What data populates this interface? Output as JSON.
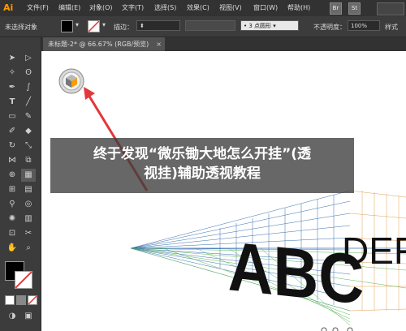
{
  "app": {
    "logo": "Ai"
  },
  "menu": [
    "文件(F)",
    "编辑(E)",
    "对象(O)",
    "文字(T)",
    "选择(S)",
    "效果(C)",
    "视图(V)",
    "窗口(W)",
    "帮助(H)"
  ],
  "app_buttons": [
    "Br",
    "St"
  ],
  "control_bar": {
    "selection_status": "未选择对象",
    "stroke_label": "描边：",
    "brush_value": "3 点圆形",
    "opacity_label": "不透明度：",
    "opacity_value": "100%",
    "style_label": "样式"
  },
  "document_tab": {
    "title": "未标题-2* @ 66.67% (RGB/预览)",
    "close": "×"
  },
  "canvas_text": {
    "left_letters": "ABC",
    "right_letters": "DEF"
  },
  "banner": {
    "line1": "终于发现“微乐锄大地怎么开挂”(透",
    "line2": "视挂)辅助透视教程"
  },
  "colors": {
    "accent": "#ff9a00",
    "fill_swatch": "#000000",
    "stroke_swatch": "#ffffff",
    "arrow": "#e2383a",
    "grid_left": "#3a6fb0",
    "grid_right": "#e0a050",
    "ground_grid": "#5cb85c"
  },
  "icons": [
    "selection-tool-icon",
    "direct-selection-tool-icon",
    "magic-wand-icon",
    "lasso-icon",
    "pen-icon",
    "curvature-icon",
    "type-icon",
    "line-icon",
    "rectangle-icon",
    "pencil-icon",
    "brush-icon",
    "eraser-icon",
    "rotate-icon",
    "scale-icon",
    "width-icon",
    "free-transform-icon",
    "shape-builder-icon",
    "perspective-grid-icon",
    "mesh-icon",
    "gradient-icon",
    "eyedropper-icon",
    "blend-icon",
    "symbol-sprayer-icon",
    "column-graph-icon",
    "artboard-icon",
    "slice-icon",
    "hand-icon",
    "zoom-icon",
    "fill-swatch-icon",
    "stroke-swatch-icon",
    "plane-switch-widget-icon",
    "arrow-annotation-icon"
  ]
}
